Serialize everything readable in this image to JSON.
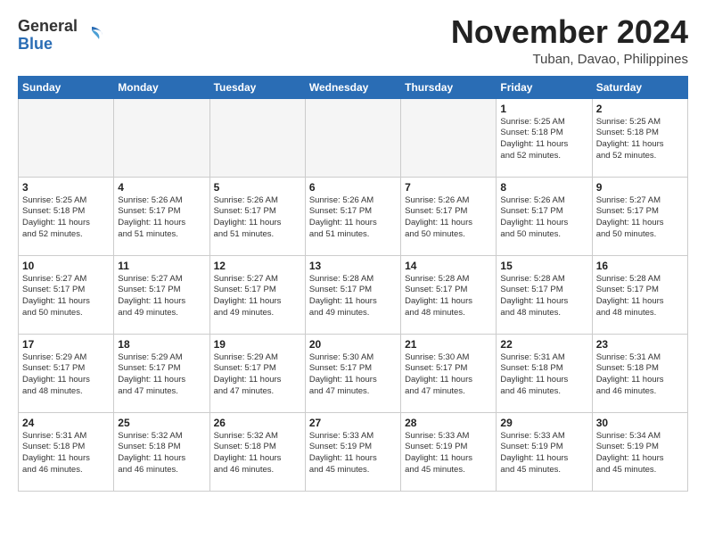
{
  "header": {
    "logo": {
      "line1": "General",
      "line2": "Blue"
    },
    "month": "November 2024",
    "location": "Tuban, Davao, Philippines"
  },
  "weekdays": [
    "Sunday",
    "Monday",
    "Tuesday",
    "Wednesday",
    "Thursday",
    "Friday",
    "Saturday"
  ],
  "weeks": [
    [
      {
        "day": "",
        "info": ""
      },
      {
        "day": "",
        "info": ""
      },
      {
        "day": "",
        "info": ""
      },
      {
        "day": "",
        "info": ""
      },
      {
        "day": "",
        "info": ""
      },
      {
        "day": "1",
        "info": "Sunrise: 5:25 AM\nSunset: 5:18 PM\nDaylight: 11 hours\nand 52 minutes."
      },
      {
        "day": "2",
        "info": "Sunrise: 5:25 AM\nSunset: 5:18 PM\nDaylight: 11 hours\nand 52 minutes."
      }
    ],
    [
      {
        "day": "3",
        "info": "Sunrise: 5:25 AM\nSunset: 5:18 PM\nDaylight: 11 hours\nand 52 minutes."
      },
      {
        "day": "4",
        "info": "Sunrise: 5:26 AM\nSunset: 5:17 PM\nDaylight: 11 hours\nand 51 minutes."
      },
      {
        "day": "5",
        "info": "Sunrise: 5:26 AM\nSunset: 5:17 PM\nDaylight: 11 hours\nand 51 minutes."
      },
      {
        "day": "6",
        "info": "Sunrise: 5:26 AM\nSunset: 5:17 PM\nDaylight: 11 hours\nand 51 minutes."
      },
      {
        "day": "7",
        "info": "Sunrise: 5:26 AM\nSunset: 5:17 PM\nDaylight: 11 hours\nand 50 minutes."
      },
      {
        "day": "8",
        "info": "Sunrise: 5:26 AM\nSunset: 5:17 PM\nDaylight: 11 hours\nand 50 minutes."
      },
      {
        "day": "9",
        "info": "Sunrise: 5:27 AM\nSunset: 5:17 PM\nDaylight: 11 hours\nand 50 minutes."
      }
    ],
    [
      {
        "day": "10",
        "info": "Sunrise: 5:27 AM\nSunset: 5:17 PM\nDaylight: 11 hours\nand 50 minutes."
      },
      {
        "day": "11",
        "info": "Sunrise: 5:27 AM\nSunset: 5:17 PM\nDaylight: 11 hours\nand 49 minutes."
      },
      {
        "day": "12",
        "info": "Sunrise: 5:27 AM\nSunset: 5:17 PM\nDaylight: 11 hours\nand 49 minutes."
      },
      {
        "day": "13",
        "info": "Sunrise: 5:28 AM\nSunset: 5:17 PM\nDaylight: 11 hours\nand 49 minutes."
      },
      {
        "day": "14",
        "info": "Sunrise: 5:28 AM\nSunset: 5:17 PM\nDaylight: 11 hours\nand 48 minutes."
      },
      {
        "day": "15",
        "info": "Sunrise: 5:28 AM\nSunset: 5:17 PM\nDaylight: 11 hours\nand 48 minutes."
      },
      {
        "day": "16",
        "info": "Sunrise: 5:28 AM\nSunset: 5:17 PM\nDaylight: 11 hours\nand 48 minutes."
      }
    ],
    [
      {
        "day": "17",
        "info": "Sunrise: 5:29 AM\nSunset: 5:17 PM\nDaylight: 11 hours\nand 48 minutes."
      },
      {
        "day": "18",
        "info": "Sunrise: 5:29 AM\nSunset: 5:17 PM\nDaylight: 11 hours\nand 47 minutes."
      },
      {
        "day": "19",
        "info": "Sunrise: 5:29 AM\nSunset: 5:17 PM\nDaylight: 11 hours\nand 47 minutes."
      },
      {
        "day": "20",
        "info": "Sunrise: 5:30 AM\nSunset: 5:17 PM\nDaylight: 11 hours\nand 47 minutes."
      },
      {
        "day": "21",
        "info": "Sunrise: 5:30 AM\nSunset: 5:17 PM\nDaylight: 11 hours\nand 47 minutes."
      },
      {
        "day": "22",
        "info": "Sunrise: 5:31 AM\nSunset: 5:18 PM\nDaylight: 11 hours\nand 46 minutes."
      },
      {
        "day": "23",
        "info": "Sunrise: 5:31 AM\nSunset: 5:18 PM\nDaylight: 11 hours\nand 46 minutes."
      }
    ],
    [
      {
        "day": "24",
        "info": "Sunrise: 5:31 AM\nSunset: 5:18 PM\nDaylight: 11 hours\nand 46 minutes."
      },
      {
        "day": "25",
        "info": "Sunrise: 5:32 AM\nSunset: 5:18 PM\nDaylight: 11 hours\nand 46 minutes."
      },
      {
        "day": "26",
        "info": "Sunrise: 5:32 AM\nSunset: 5:18 PM\nDaylight: 11 hours\nand 46 minutes."
      },
      {
        "day": "27",
        "info": "Sunrise: 5:33 AM\nSunset: 5:19 PM\nDaylight: 11 hours\nand 45 minutes."
      },
      {
        "day": "28",
        "info": "Sunrise: 5:33 AM\nSunset: 5:19 PM\nDaylight: 11 hours\nand 45 minutes."
      },
      {
        "day": "29",
        "info": "Sunrise: 5:33 AM\nSunset: 5:19 PM\nDaylight: 11 hours\nand 45 minutes."
      },
      {
        "day": "30",
        "info": "Sunrise: 5:34 AM\nSunset: 5:19 PM\nDaylight: 11 hours\nand 45 minutes."
      }
    ]
  ]
}
